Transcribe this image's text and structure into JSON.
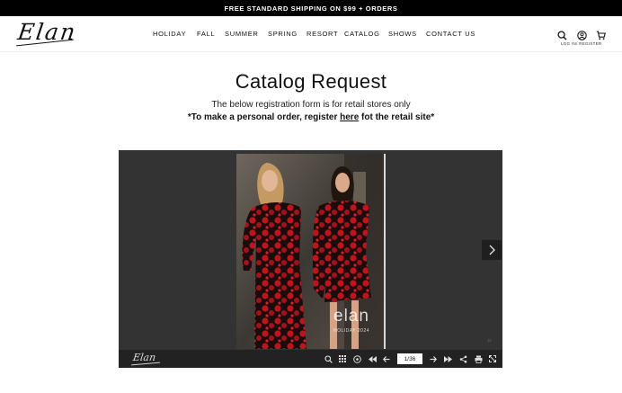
{
  "promo_bar": {
    "text": "FREE STANDARD SHIPPING ON $99 + ORDERS"
  },
  "header": {
    "logo_text": "Elan",
    "nav": [
      "HOLIDAY",
      "FALL",
      "SUMMER",
      "SPRING",
      "RESORT",
      "CATALOG",
      "SHOWS",
      "CONTACT US"
    ],
    "login_label": "LOG IN/ REGISTER",
    "icons": [
      "search-icon",
      "account-icon",
      "cart-icon"
    ]
  },
  "main": {
    "title": "Catalog Request",
    "subtitle": "The below registration form is for retail stores only",
    "note_prefix": "*To make a personal order, register ",
    "note_link": "here",
    "note_suffix": " fot the retail site*"
  },
  "viewer": {
    "cover_brand": "elan",
    "cover_sub": "HOLIDAY 2024",
    "toolbar_logo": "Elan",
    "page_indicator": "1/36",
    "toolbar_icons": [
      "zoom-icon",
      "grid-icon",
      "autoplay-icon",
      "first-page-icon",
      "prev-page-icon",
      "next-page-icon",
      "last-page-icon",
      "share-icon",
      "print-icon",
      "fullscreen-icon"
    ]
  },
  "colors": {
    "promo_bg": "#000000",
    "viewer_bg": "#333333",
    "toolbar_bg": "#222222",
    "dress_red": "#b3161d"
  }
}
